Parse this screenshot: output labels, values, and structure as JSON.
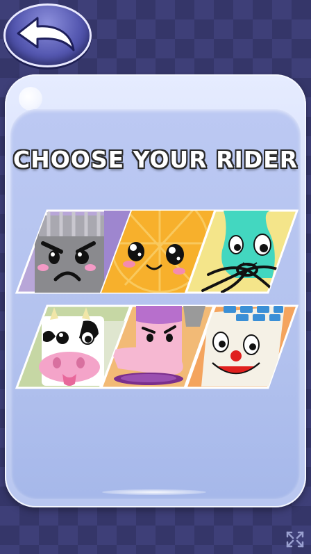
{
  "screen": {
    "title": "CHOOSE YOUR RIDER"
  },
  "icons": {
    "back": "back-arrow-icon",
    "fullscreen": "fullscreen-icon"
  },
  "riders": [
    {
      "id": "trash-can",
      "color": "#b8a6d8"
    },
    {
      "id": "orange",
      "color": "#f6a623"
    },
    {
      "id": "green-blob",
      "color": "#f4e58a"
    },
    {
      "id": "cow",
      "color": "#c6d7a4"
    },
    {
      "id": "purple-tongue",
      "color": "#f2ba76"
    },
    {
      "id": "calculator",
      "color": "#f4a45e"
    }
  ],
  "colors": {
    "background": "#3e3f78",
    "panel": "#b8c6f0",
    "title_text": "#ffffff",
    "title_outline": "#2a2a2a"
  }
}
